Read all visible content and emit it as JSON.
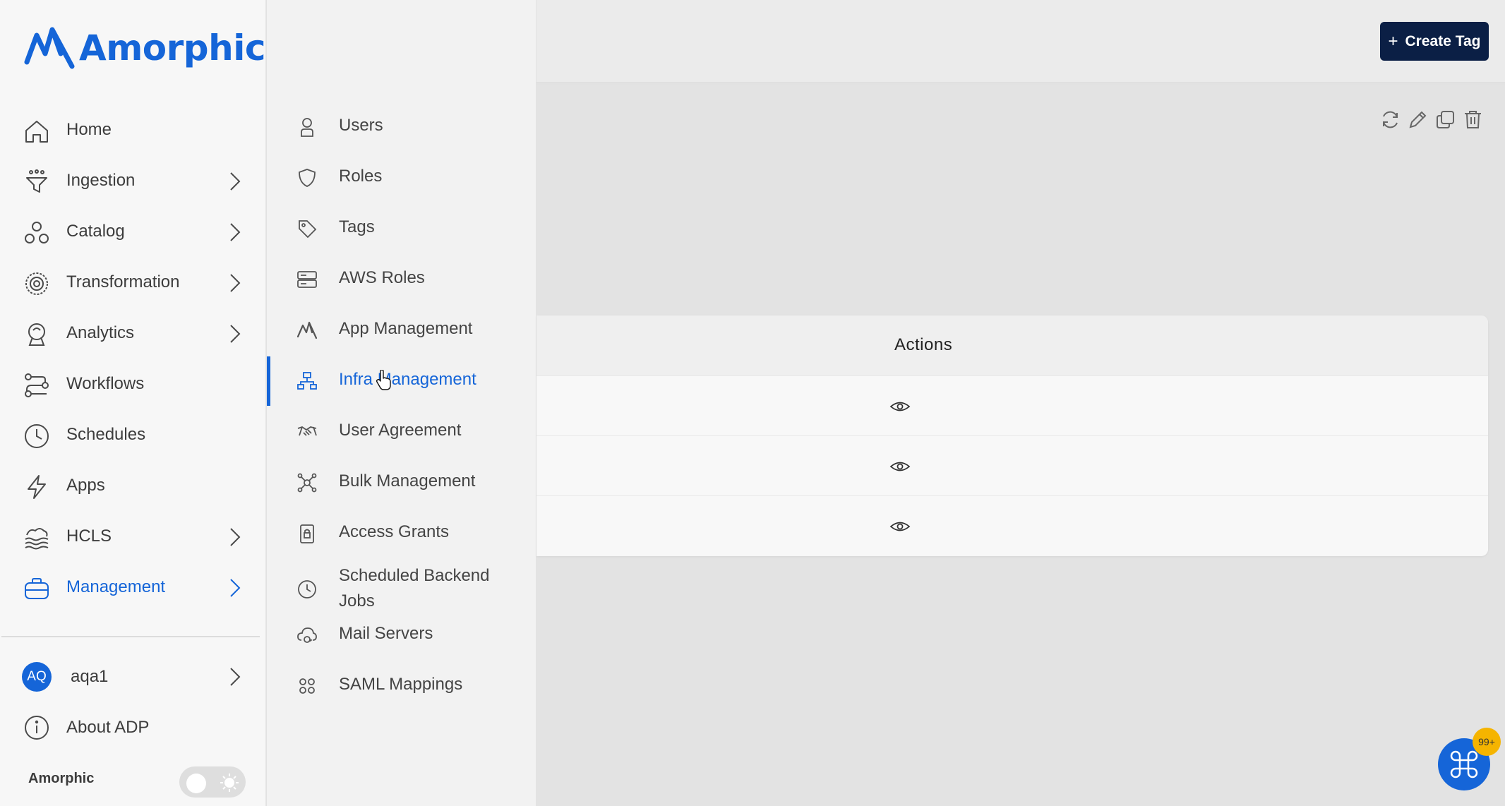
{
  "app": {
    "logo_text": "Amorphic",
    "brand_label": "Amorphic",
    "accent_color": "#1565d8"
  },
  "sidebar": {
    "items": [
      {
        "label": "Home",
        "icon": "home-icon",
        "has_submenu": false
      },
      {
        "label": "Ingestion",
        "icon": "funnel-icon",
        "has_submenu": true
      },
      {
        "label": "Catalog",
        "icon": "catalog-icon",
        "has_submenu": true
      },
      {
        "label": "Transformation",
        "icon": "gear-icon",
        "has_submenu": true
      },
      {
        "label": "Analytics",
        "icon": "analytics-icon",
        "has_submenu": true
      },
      {
        "label": "Workflows",
        "icon": "workflow-icon",
        "has_submenu": false
      },
      {
        "label": "Schedules",
        "icon": "clock-icon",
        "has_submenu": false
      },
      {
        "label": "Apps",
        "icon": "lightning-icon",
        "has_submenu": false
      },
      {
        "label": "HCLS",
        "icon": "waves-icon",
        "has_submenu": true
      },
      {
        "label": "Management",
        "icon": "briefcase-icon",
        "has_submenu": true,
        "active": true
      }
    ],
    "user": {
      "initials": "AQ",
      "name": "aqa1"
    },
    "about_label": "About ADP",
    "theme_icon": "sun-icon"
  },
  "submenu": {
    "items": [
      {
        "label": "Users",
        "icon": "user-icon"
      },
      {
        "label": "Roles",
        "icon": "shield-icon"
      },
      {
        "label": "Tags",
        "icon": "tag-icon"
      },
      {
        "label": "AWS Roles",
        "icon": "server-icon"
      },
      {
        "label": "App Management",
        "icon": "app-logo-icon"
      },
      {
        "label": "Infra Management",
        "icon": "network-icon",
        "active": true
      },
      {
        "label": "User Agreement",
        "icon": "handshake-icon"
      },
      {
        "label": "Bulk Management",
        "icon": "nodes-icon"
      },
      {
        "label": "Access Grants",
        "icon": "lock-icon"
      },
      {
        "label": "Scheduled Backend Jobs",
        "icon": "clock-icon"
      },
      {
        "label": "Mail Servers",
        "icon": "mail-cloud-icon"
      },
      {
        "label": "SAML Mappings",
        "icon": "group-icon"
      }
    ]
  },
  "header": {
    "create_button_label": "Create Tag",
    "create_button_icon": "plus-icon"
  },
  "toolbar": {
    "icons": [
      "refresh-icon",
      "edit-icon",
      "copy-icon",
      "trash-icon"
    ]
  },
  "table": {
    "columns": [
      "Actions"
    ],
    "rows": [
      {
        "action_icon": "eye-icon"
      },
      {
        "action_icon": "eye-icon"
      },
      {
        "action_icon": "eye-icon"
      }
    ]
  },
  "command_button": {
    "icon": "command-icon",
    "badge": "99+",
    "badge_color": "#f5b400"
  }
}
